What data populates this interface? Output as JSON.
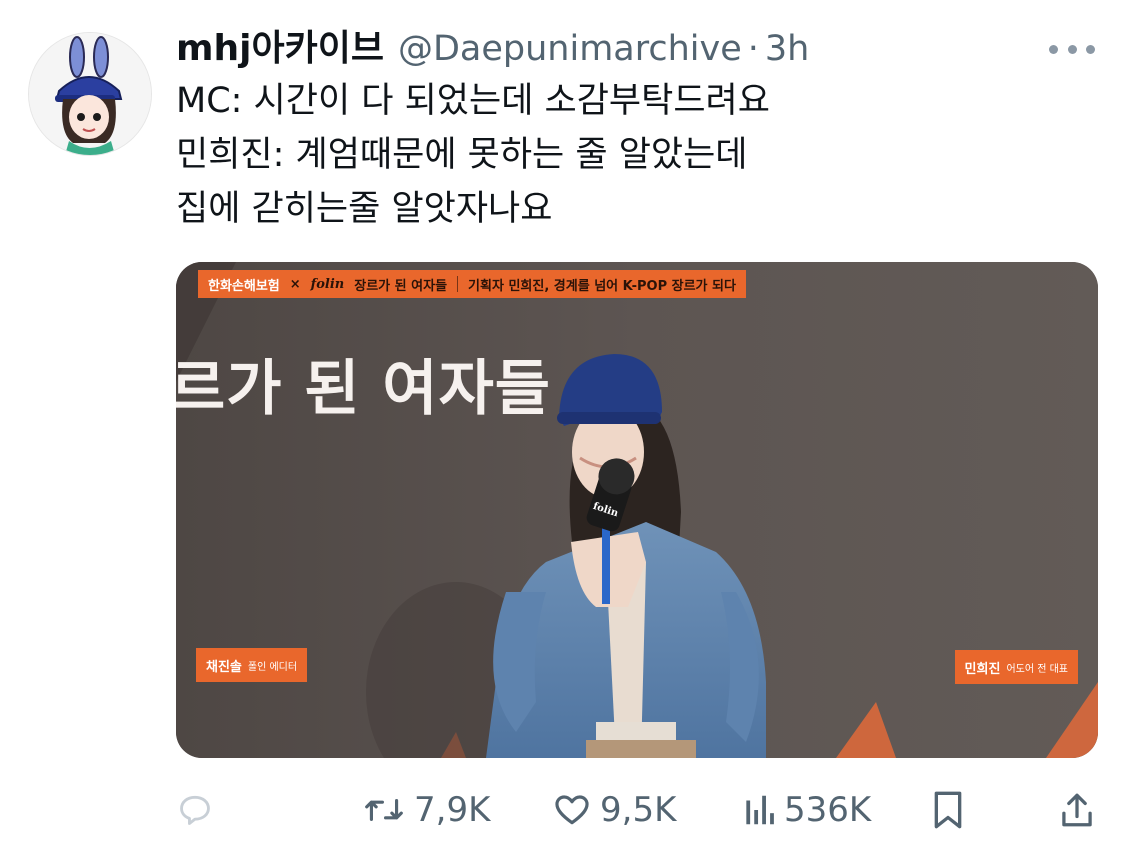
{
  "tweet": {
    "display_name": "mhj아카이브",
    "handle": "@Daepunimarchive",
    "separator": "·",
    "time": "3h",
    "text_lines": [
      "MC: 시간이 다 되었는데 소감부탁드려요",
      "민희진: 계엄때문에 못하는 줄 알았는데",
      "집에 갇히는줄 알앗자나요"
    ]
  },
  "media": {
    "banner": {
      "insurer": "한화손해보험",
      "x": "×",
      "brand": "folin",
      "series": "장르가 된 여자들",
      "subtitle": "기획자 민희진, 경계를 넘어 K-POP 장르가 되다"
    },
    "headline": "르가 된 여자들",
    "caption_left": {
      "name": "채진솔",
      "role": "폴인 에디터"
    },
    "caption_right": {
      "name": "민희진",
      "role": "어도어 전 대표"
    },
    "mic_label": "folin"
  },
  "actions": {
    "reply_count": "",
    "retweet_count": "7,9K",
    "like_count": "9,5K",
    "views_count": "536K"
  },
  "icons": {
    "more": "more-icon",
    "reply": "reply-icon",
    "retweet": "retweet-icon",
    "like": "heart-icon",
    "views": "views-icon",
    "bookmark": "bookmark-icon",
    "share": "share-icon"
  },
  "colors": {
    "text": "#0f1419",
    "muted": "#536471",
    "banner_orange": "#e9672c",
    "backdrop": "#5b5350"
  }
}
